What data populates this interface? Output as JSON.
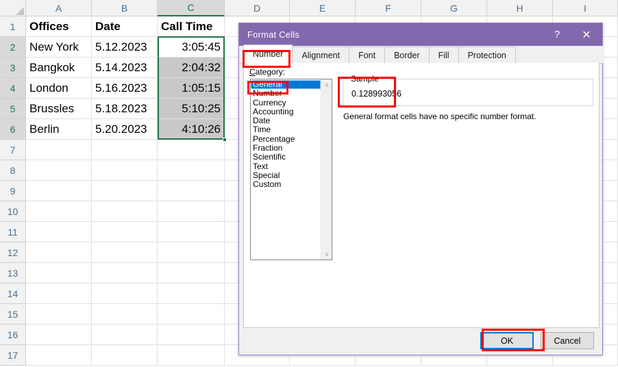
{
  "colors": {
    "dialog_title_bg": "#8268ae",
    "selection_green": "#217346",
    "list_selected_blue": "#0078d7",
    "annotation_red": "#ff0000",
    "focus_blue": "#0078d7",
    "shaded_cell": "#c8c8c8"
  },
  "spreadsheet": {
    "column_headers": [
      "A",
      "B",
      "C",
      "D",
      "E",
      "F",
      "G",
      "H",
      "I"
    ],
    "selected_column": "C",
    "row_headers": [
      "1",
      "2",
      "3",
      "4",
      "5",
      "6",
      "7",
      "8",
      "9",
      "10",
      "11",
      "12",
      "13",
      "14",
      "15",
      "16",
      "17"
    ],
    "rows": [
      {
        "a": "Offices",
        "b": "Date",
        "c": "Call Time"
      },
      {
        "a": "New York",
        "b": "5.12.2023",
        "c": "3:05:45"
      },
      {
        "a": "Bangkok",
        "b": "5.14.2023",
        "c": "2:04:32"
      },
      {
        "a": "London",
        "b": "5.16.2023",
        "c": "1:05:15"
      },
      {
        "a": "Brussles",
        "b": "5.18.2023",
        "c": "5:10:25"
      },
      {
        "a": "Berlin",
        "b": "5.20.2023",
        "c": "4:10:26"
      }
    ]
  },
  "dialog": {
    "title": "Format Cells",
    "help_glyph": "?",
    "close_glyph": "✕",
    "tabs": [
      {
        "label": "Number",
        "active": true
      },
      {
        "label": "Alignment",
        "active": false
      },
      {
        "label": "Font",
        "active": false
      },
      {
        "label": "Border",
        "active": false
      },
      {
        "label": "Fill",
        "active": false
      },
      {
        "label": "Protection",
        "active": false
      }
    ],
    "category_label": "Category:",
    "categories": [
      "General",
      "Number",
      "Currency",
      "Accounting",
      "Date",
      "Time",
      "Percentage",
      "Fraction",
      "Scientific",
      "Text",
      "Special",
      "Custom"
    ],
    "selected_category": "General",
    "scroll_up_glyph": "∧",
    "scroll_down_glyph": "∨",
    "sample_legend": "Sample",
    "sample_value": "0.128993056",
    "description": "General format cells have no specific number format.",
    "buttons": {
      "ok": "OK",
      "cancel": "Cancel"
    }
  }
}
